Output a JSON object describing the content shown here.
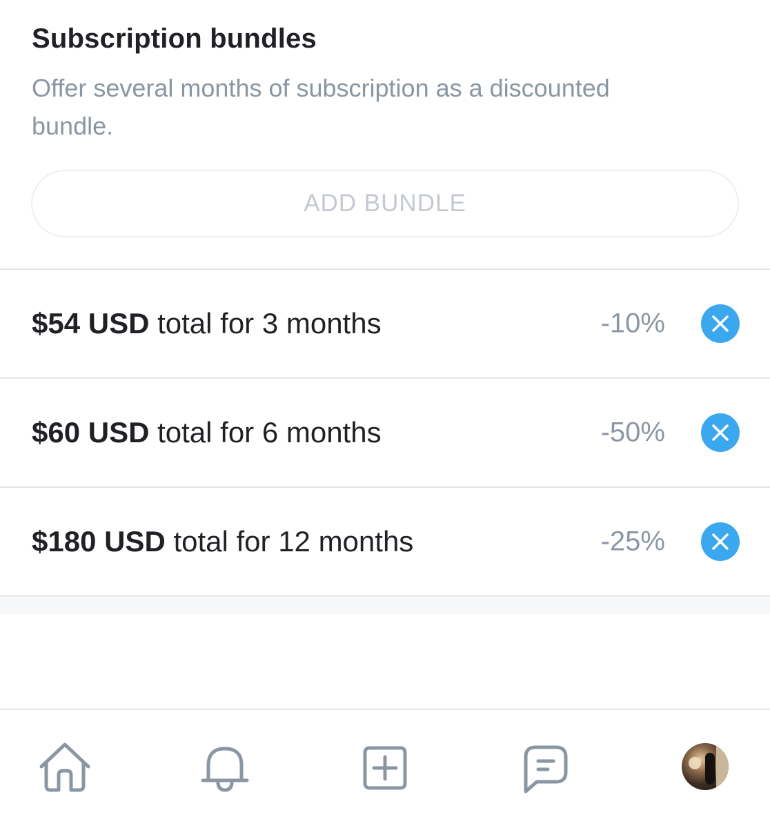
{
  "section": {
    "title": "Subscription bundles",
    "description": "Offer several months of subscription as a discounted bundle."
  },
  "add_bundle_label": "ADD BUNDLE",
  "bundles": [
    {
      "price": "$54 USD",
      "text": " total for 3 months",
      "discount": "-10%"
    },
    {
      "price": "$60 USD",
      "text": " total for 6 months",
      "discount": "-50%"
    },
    {
      "price": "$180 USD",
      "text": " total for 12 months",
      "discount": "-25%"
    }
  ],
  "colors": {
    "accent": "#3aa7ee",
    "muted_text": "#8a96a3",
    "icon": "#8a96a3"
  },
  "nav": {
    "items": [
      "home-icon",
      "bell-icon",
      "add-post-icon",
      "messages-icon",
      "avatar"
    ]
  }
}
